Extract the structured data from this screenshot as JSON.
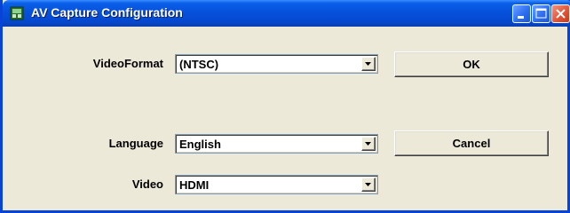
{
  "window": {
    "title": "AV Capture Configuration"
  },
  "titlebar_buttons": [
    "minimize",
    "maximize",
    "close"
  ],
  "form": {
    "video_format": {
      "label": "VideoFormat",
      "value": "(NTSC)"
    },
    "language": {
      "label": "Language",
      "value": "English"
    },
    "video": {
      "label": "Video",
      "value": "HDMI"
    }
  },
  "buttons": {
    "ok": "OK",
    "cancel": "Cancel"
  },
  "colors": {
    "titlebar": "#0651dc",
    "face": "#ece9d8",
    "close": "#e2563a"
  }
}
